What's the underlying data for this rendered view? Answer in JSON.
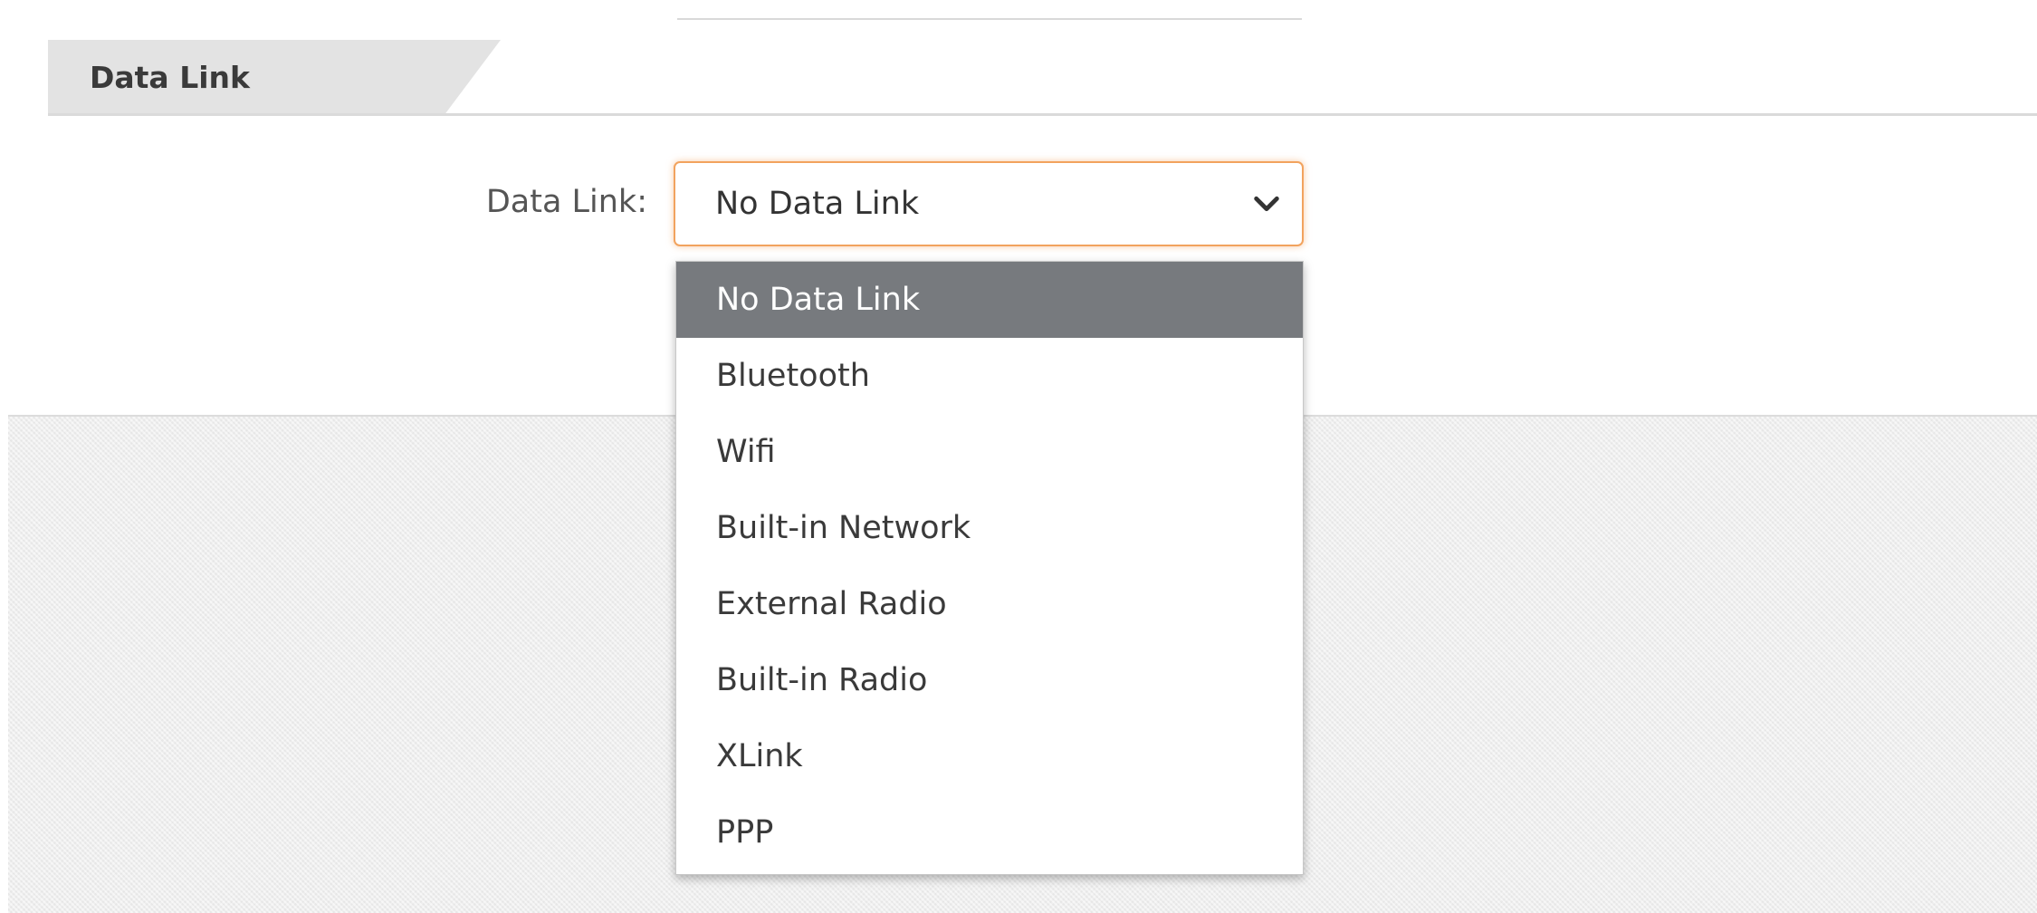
{
  "section": {
    "title": "Data Link"
  },
  "field": {
    "label": "Data Link:",
    "selected_value": "No Data Link",
    "focus_color": "#f2a35e"
  },
  "dropdown": {
    "highlight_color": "#777a7e",
    "options": [
      "No Data Link",
      "Bluetooth",
      "Wifi",
      "Built-in Network",
      "External Radio",
      "Built-in Radio",
      "XLink",
      "PPP"
    ]
  },
  "icons": {
    "select_arrow": "chevron-down-icon"
  }
}
